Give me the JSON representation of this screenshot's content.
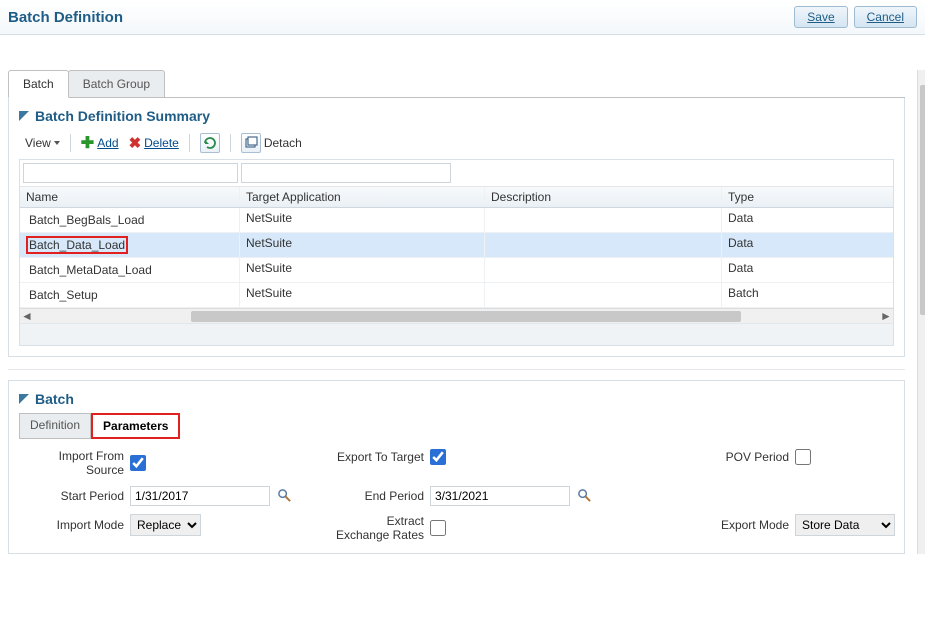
{
  "header": {
    "title": "Batch Definition",
    "save": "Save",
    "cancel": "Cancel"
  },
  "tabs": {
    "batch": "Batch",
    "batch_group": "Batch Group"
  },
  "summary": {
    "title": "Batch Definition Summary",
    "toolbar": {
      "view": "View",
      "add": "Add",
      "delete": "Delete",
      "detach": "Detach"
    },
    "columns": {
      "name": "Name",
      "target_app": "Target Application",
      "description": "Description",
      "type": "Type"
    },
    "rows": [
      {
        "name": "Batch_BegBals_Load",
        "app": "NetSuite",
        "desc": "",
        "type": "Data",
        "selected": false
      },
      {
        "name": "Batch_Data_Load",
        "app": "NetSuite",
        "desc": "",
        "type": "Data",
        "selected": true,
        "highlight": true
      },
      {
        "name": "Batch_MetaData_Load",
        "app": "NetSuite",
        "desc": "",
        "type": "Data",
        "selected": false
      },
      {
        "name": "Batch_Setup",
        "app": "NetSuite",
        "desc": "",
        "type": "Batch",
        "selected": false
      }
    ]
  },
  "batch_panel": {
    "title": "Batch",
    "tabs": {
      "definition": "Definition",
      "parameters": "Parameters"
    },
    "form": {
      "import_from_source_label": "Import From Source",
      "import_from_source": true,
      "export_to_target_label": "Export To Target",
      "export_to_target": true,
      "pov_period_label": "POV Period",
      "pov_period": false,
      "start_period_label": "Start Period",
      "start_period": "1/31/2017",
      "end_period_label": "End Period",
      "end_period": "3/31/2021",
      "import_mode_label": "Import Mode",
      "import_mode": "Replace",
      "extract_exchange_label": "Extract Exchange Rates",
      "extract_exchange": false,
      "export_mode_label": "Export Mode",
      "export_mode": "Store Data"
    }
  }
}
